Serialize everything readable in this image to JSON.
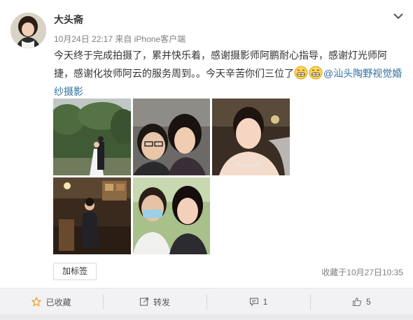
{
  "post": {
    "username": "大头斋",
    "timestamp": "10月24日 22:17",
    "source_prefix": "来自",
    "source": "iPhone客户端",
    "text_part1": "今天终于完成拍摄了，累并快乐着，感谢摄影师阿鹏耐心指导，感谢灯光师阿捷，感谢化妆师阿云的服务周到。。今天辛苦你们三位了",
    "mention": "@汕头陶野视觉婚纱摄影",
    "emoji": "grin-emoji"
  },
  "photos": [
    {
      "name": "photo-couple-garden"
    },
    {
      "name": "photo-selfie-couple"
    },
    {
      "name": "photo-bride-portrait"
    },
    {
      "name": "photo-man-seated"
    },
    {
      "name": "photo-two-women"
    }
  ],
  "tag_button": "加标签",
  "favorited_time": "收藏于10月27日10:35",
  "actions": {
    "favorite": "已收藏",
    "repost": "转发",
    "comment": "1",
    "like": "5"
  },
  "icons": {
    "favorite": "star-icon",
    "repost": "repost-icon",
    "comment": "comment-icon",
    "like": "thumbs-up-icon",
    "menu": "chevron-down-icon"
  },
  "colors": {
    "link": "#2f6f9f",
    "favorite_star": "#f0a030",
    "action_bar": "#f2f2f5"
  }
}
